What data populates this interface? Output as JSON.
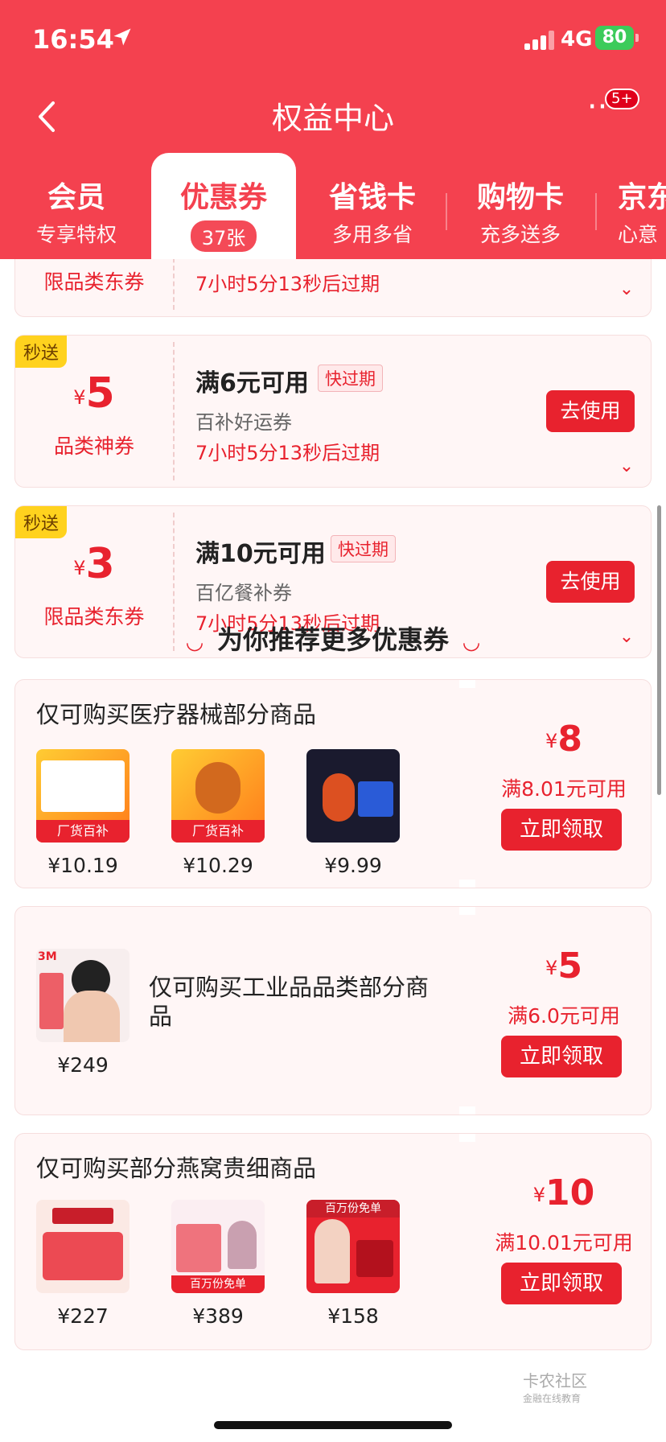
{
  "status": {
    "time": "16:54",
    "network": "4G",
    "battery": "80"
  },
  "nav": {
    "title": "权益中心",
    "badge": "5+"
  },
  "tabs": [
    {
      "title": "会员",
      "sub": "专享特权"
    },
    {
      "title": "优惠券",
      "sub": "37张"
    },
    {
      "title": "省钱卡",
      "sub": "多用多省"
    },
    {
      "title": "购物卡",
      "sub": "充多送多"
    },
    {
      "title": "京东",
      "sub": "心意"
    }
  ],
  "coupons": [
    {
      "type": "限品类东券",
      "expire": "7小时5分13秒后过期"
    },
    {
      "tag": "秒送",
      "currency": "¥",
      "amount": "5",
      "type": "品类神券",
      "condition": "满6元可用",
      "badge": "快过期",
      "name": "百补好运券",
      "expire": "7小时5分13秒后过期",
      "action": "去使用"
    },
    {
      "tag": "秒送",
      "currency": "¥",
      "amount": "3",
      "type": "限品类东券",
      "condition": "满10元可用",
      "badge": "快过期",
      "name": "百亿餐补券",
      "expire": "7小时5分13秒后过期",
      "action": "去使用"
    }
  ],
  "recommend": {
    "title": "为你推荐更多优惠券",
    "cards": [
      {
        "title": "仅可购买医疗器械部分商品",
        "currency": "¥",
        "amount": "8",
        "condition": "满8.01元可用",
        "action": "立即领取",
        "products": [
          {
            "price": "¥10.19",
            "label": "厂货百补"
          },
          {
            "price": "¥10.29",
            "label": "厂货百补"
          },
          {
            "price": "¥9.99",
            "label": ""
          }
        ]
      },
      {
        "title": "仅可购买工业品品类部分商品",
        "currency": "¥",
        "amount": "5",
        "condition": "满6.0元可用",
        "action": "立即领取",
        "products": [
          {
            "price": "¥249",
            "label": "3M"
          }
        ]
      },
      {
        "title": "仅可购买部分燕窝贵细商品",
        "currency": "¥",
        "amount": "10",
        "condition": "满10.01元可用",
        "action": "立即领取",
        "products": [
          {
            "price": "¥227",
            "label": ""
          },
          {
            "price": "¥389",
            "label": "百万份免单"
          },
          {
            "price": "¥158",
            "label": "百万份免单"
          }
        ]
      }
    ]
  },
  "watermark": {
    "title": "卡农社区",
    "sub": "金融在线教育"
  }
}
